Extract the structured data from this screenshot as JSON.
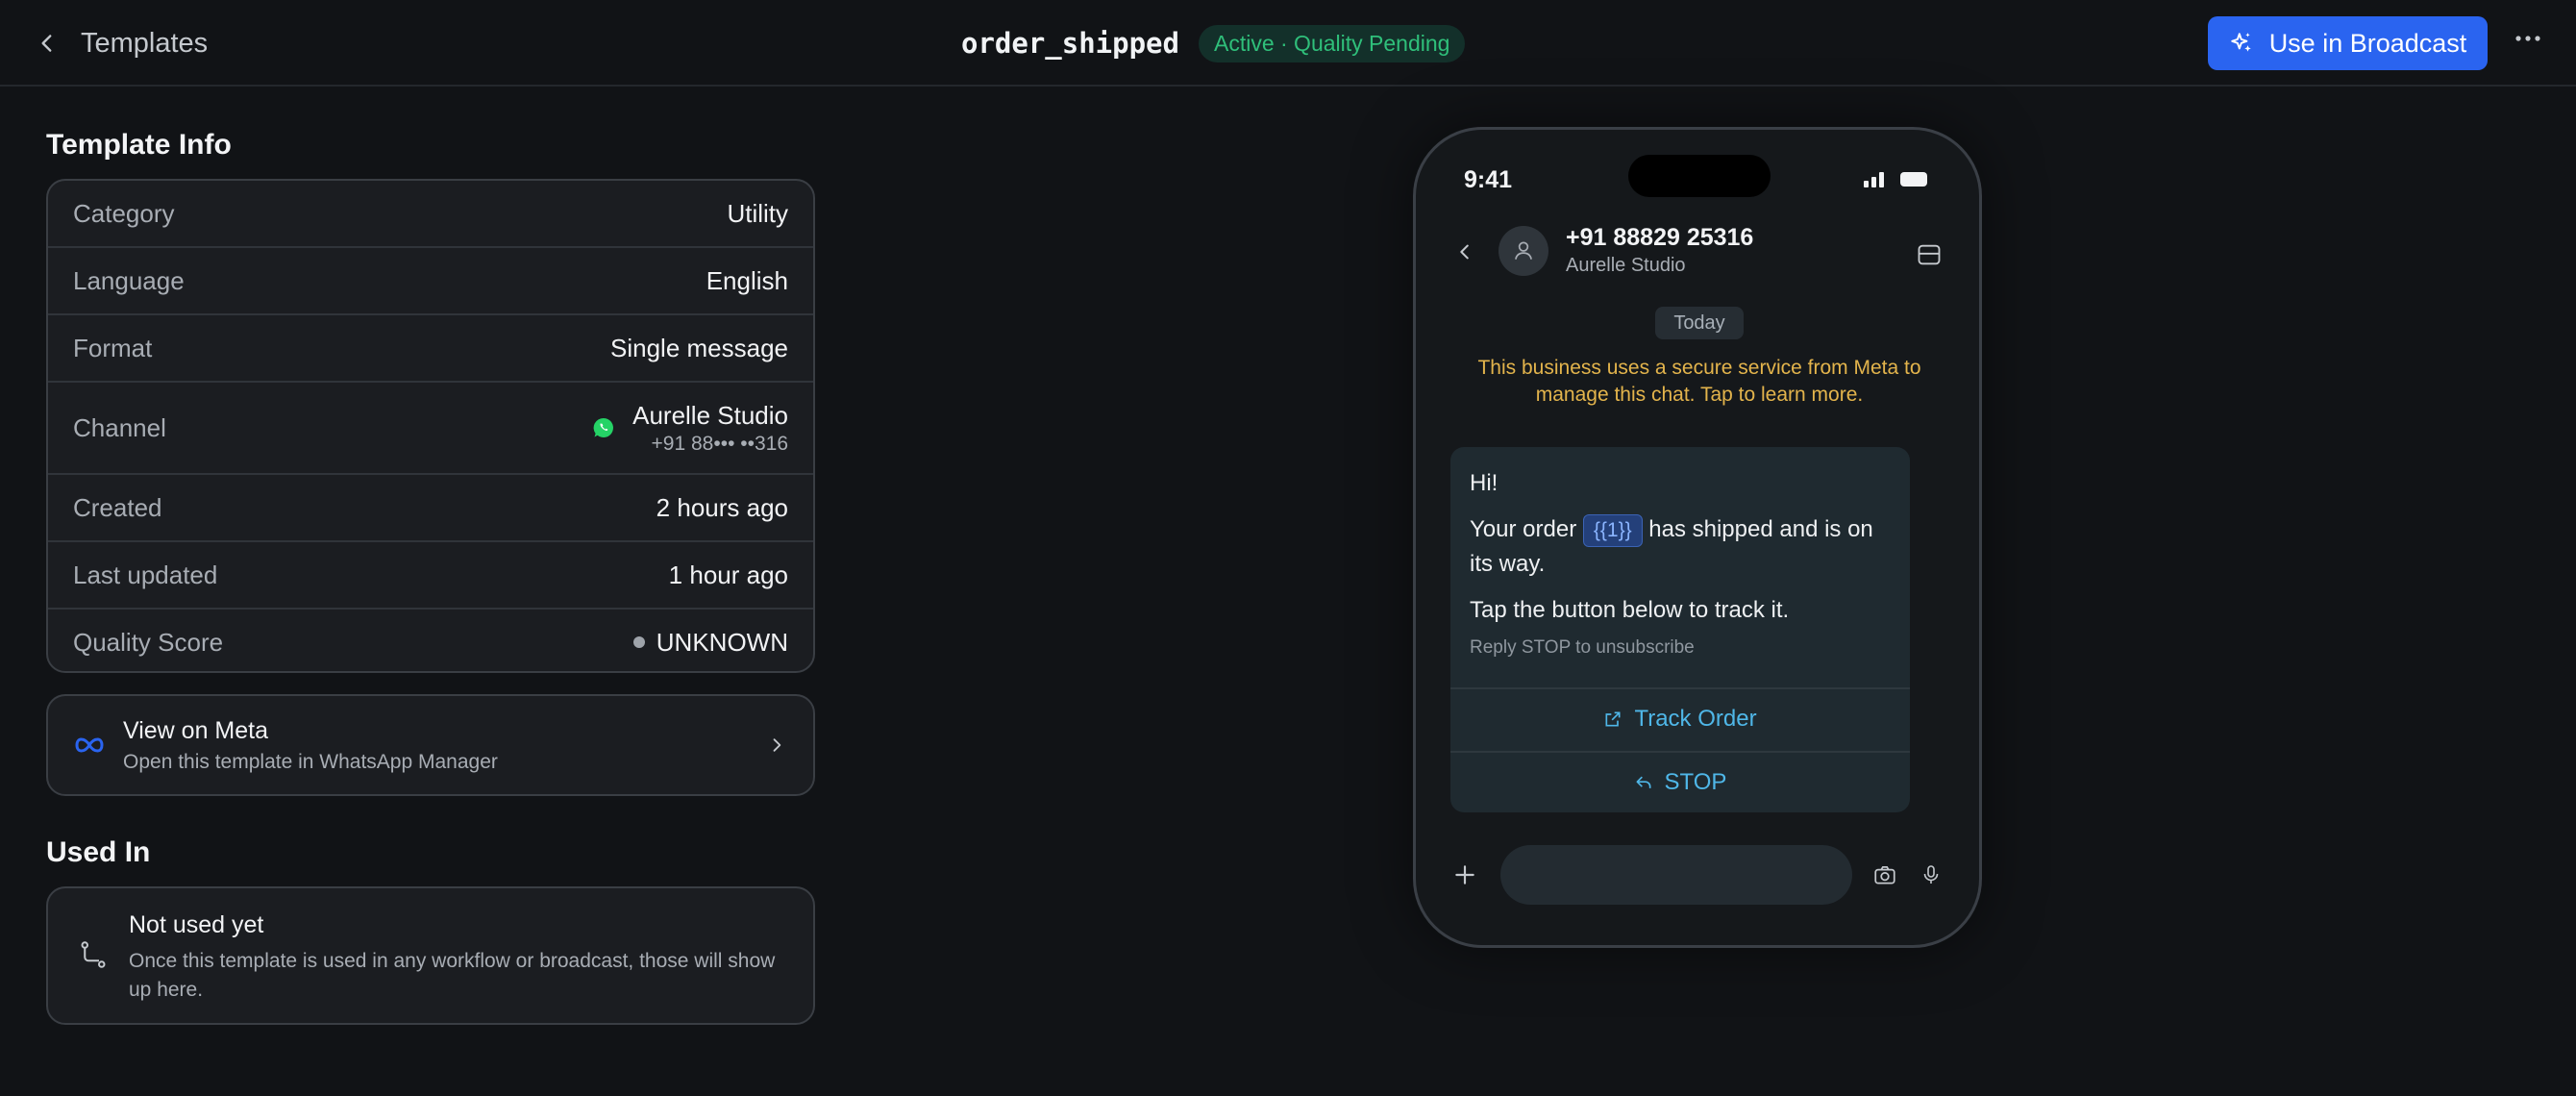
{
  "header": {
    "back_label": "Templates",
    "template_name": "order_shipped",
    "status": "Active · Quality Pending",
    "broadcast_label": "Use in Broadcast"
  },
  "template_info": {
    "title": "Template Info",
    "rows": [
      {
        "label": "Category",
        "value": "Utility"
      },
      {
        "label": "Language",
        "value": "English"
      },
      {
        "label": "Format",
        "value": "Single message"
      },
      {
        "label": "Channel",
        "value": "Aurelle Studio",
        "sub": "+91 88••• ••316"
      },
      {
        "label": "Created",
        "value": "2 hours ago"
      },
      {
        "label": "Last updated",
        "value": "1 hour ago"
      },
      {
        "label": "Quality Score",
        "value": "UNKNOWN"
      }
    ]
  },
  "meta_link": {
    "title": "View on Meta",
    "subtitle": "Open this template in WhatsApp Manager"
  },
  "used_in": {
    "title": "Used In",
    "empty_title": "Not used yet",
    "empty_desc": "Once this template is used in any workflow or broadcast, those will show up here."
  },
  "phone": {
    "time": "9:41",
    "contact_number": "+91 88829 25316",
    "contact_name": "Aurelle Studio",
    "date_chip": "Today",
    "notice": "This business uses a secure service from Meta to manage this chat. Tap to learn more.",
    "message": {
      "greeting": "Hi!",
      "line_prefix": "Your order",
      "variable": "{{1}}",
      "line_suffix": "has shipped and is on its way.",
      "cta": "Tap the button below to track it.",
      "footer": "Reply STOP to unsubscribe"
    },
    "buttons": [
      {
        "label": "Track Order",
        "icon": "external-link-icon"
      },
      {
        "label": "STOP",
        "icon": "reply-icon"
      }
    ]
  },
  "colors": {
    "background": "#111316",
    "card": "#1b1d21",
    "accent": "#2a64f0",
    "status_green": "#2fbf7a",
    "whatsapp_green": "#25d366",
    "notice_yellow": "#e3b44c",
    "link_blue": "#4fb7e8"
  }
}
